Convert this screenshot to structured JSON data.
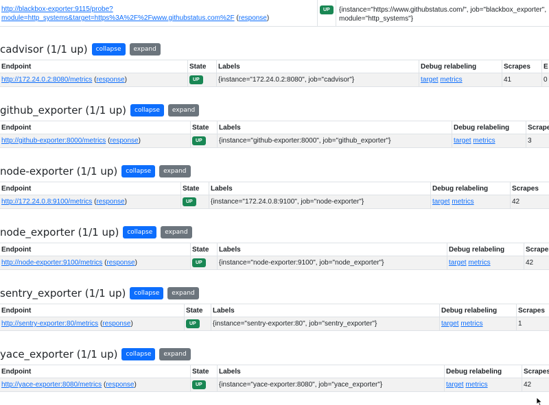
{
  "blackbox_row": {
    "endpoint": "http://blackbox-exporter:9115/probe?module=http_systems&target=https%3A%2F%2Fwww.githubstatus.com%2F",
    "response_label": "response",
    "state": "UP",
    "labels": "{instance=\"https://www.githubstatus.com/\", job=\"blackbox_exporter\", module=\"http_systems\"}"
  },
  "buttons": {
    "collapse": "collapse",
    "expand": "expand"
  },
  "headers": {
    "endpoint": "Endpoint",
    "state": "State",
    "labels": "Labels",
    "debug": "Debug relabeling",
    "scrapes": "Scrapes",
    "extra": "E"
  },
  "debug_links": {
    "target": "target",
    "metrics": "metrics"
  },
  "jobs": [
    {
      "title": "cadvisor (1/1 up)",
      "endpoint": "http://172.24.0.2:8080/metrics",
      "state": "UP",
      "labels": "{instance=\"172.24.0.2:8080\", job=\"cadvisor\"}",
      "scrapes": "41",
      "extra": "0"
    },
    {
      "title": "github_exporter (1/1 up)",
      "endpoint": "http://github-exporter:8000/metrics",
      "state": "UP",
      "labels": "{instance=\"github-exporter:8000\", job=\"github_exporter\"}",
      "scrapes": "3"
    },
    {
      "title": "node-exporter (1/1 up)",
      "endpoint": "http://172.24.0.8:9100/metrics",
      "state": "UP",
      "labels": "{instance=\"172.24.0.8:9100\", job=\"node-exporter\"}",
      "scrapes": "42"
    },
    {
      "title": "node_exporter (1/1 up)",
      "endpoint": "http://node-exporter:9100/metrics",
      "state": "UP",
      "labels": "{instance=\"node-exporter:9100\", job=\"node_exporter\"}",
      "scrapes": "42"
    },
    {
      "title": "sentry_exporter (1/1 up)",
      "endpoint": "http://sentry-exporter:80/metrics",
      "state": "UP",
      "labels": "{instance=\"sentry-exporter:80\", job=\"sentry_exporter\"}",
      "scrapes": "1"
    },
    {
      "title": "yace_exporter (1/1 up)",
      "endpoint": "http://yace-exporter:8080/metrics",
      "state": "UP",
      "labels": "{instance=\"yace-exporter:8080\", job=\"yace_exporter\"}",
      "scrapes": "42"
    }
  ],
  "colors": {
    "link": "#0d6efd",
    "up_badge": "#198754",
    "collapse_btn": "#0d6efd",
    "expand_btn": "#6c757d",
    "row_bg": "#f2f2f2"
  }
}
